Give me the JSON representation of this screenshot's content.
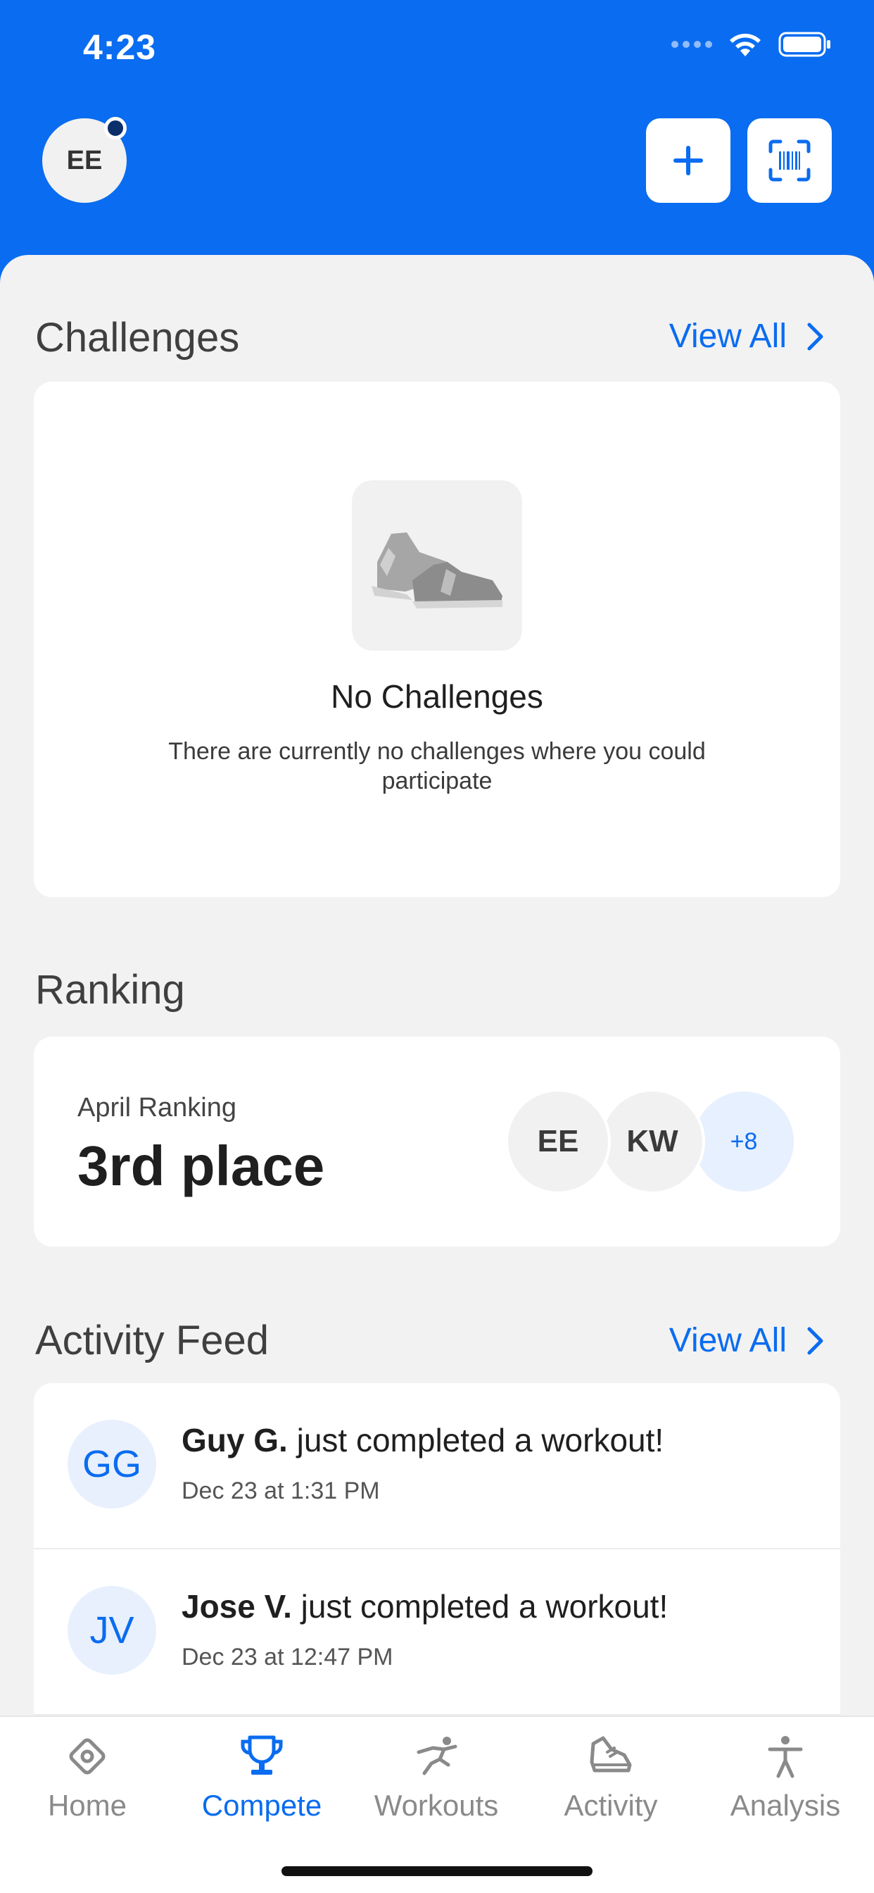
{
  "status_bar": {
    "time": "4:23"
  },
  "header": {
    "avatar_initials": "EE"
  },
  "challenges": {
    "title": "Challenges",
    "view_all": "View All",
    "empty_title": "No Challenges",
    "empty_description": "There are currently no challenges where you could participate"
  },
  "ranking": {
    "title": "Ranking",
    "label": "April Ranking",
    "value": "3rd place",
    "avatars": [
      "EE",
      "KW"
    ],
    "more": "+8"
  },
  "activity_feed": {
    "title": "Activity Feed",
    "view_all": "View All",
    "items": [
      {
        "initials": "GG",
        "name": "Guy G.",
        "action": " just completed a workout!",
        "time": "Dec 23 at 1:31 PM"
      },
      {
        "initials": "JV",
        "name": "Jose V.",
        "action": " just completed a workout!",
        "time": "Dec 23 at 12:47 PM"
      }
    ]
  },
  "tabs": [
    {
      "label": "Home",
      "icon": "home-icon",
      "active": false
    },
    {
      "label": "Compete",
      "icon": "trophy-icon",
      "active": true
    },
    {
      "label": "Workouts",
      "icon": "runner-icon",
      "active": false
    },
    {
      "label": "Activity",
      "icon": "shoe-icon",
      "active": false
    },
    {
      "label": "Analysis",
      "icon": "person-icon",
      "active": false
    }
  ],
  "colors": {
    "accent": "#0a6cf0",
    "background": "#f2f2f2",
    "card": "#ffffff"
  }
}
